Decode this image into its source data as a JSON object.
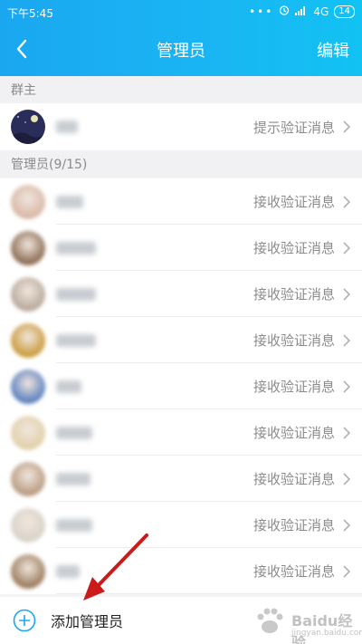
{
  "status_bar": {
    "time": "下午5:45",
    "network": "4G",
    "battery": "14"
  },
  "nav": {
    "title": "管理员",
    "edit": "编辑"
  },
  "sections": {
    "owner": "群主",
    "admins": "管理员(9/15)"
  },
  "owner": {
    "status": "提示验证消息"
  },
  "admins": [
    {
      "status": "接收验证消息"
    },
    {
      "status": "接收验证消息"
    },
    {
      "status": "接收验证消息"
    },
    {
      "status": "接收验证消息"
    },
    {
      "status": "接收验证消息"
    },
    {
      "status": "接收验证消息"
    },
    {
      "status": "接收验证消息"
    },
    {
      "status": "接收验证消息"
    },
    {
      "status": "接收验证消息"
    }
  ],
  "add": {
    "label": "添加管理员"
  },
  "watermark": {
    "brand": "Baidu经验",
    "url": "jingyan.baidu.com"
  },
  "colors": {
    "header": "#19b6f3",
    "accent": "#1aa7f0",
    "annotation": "#cc1a1a"
  }
}
